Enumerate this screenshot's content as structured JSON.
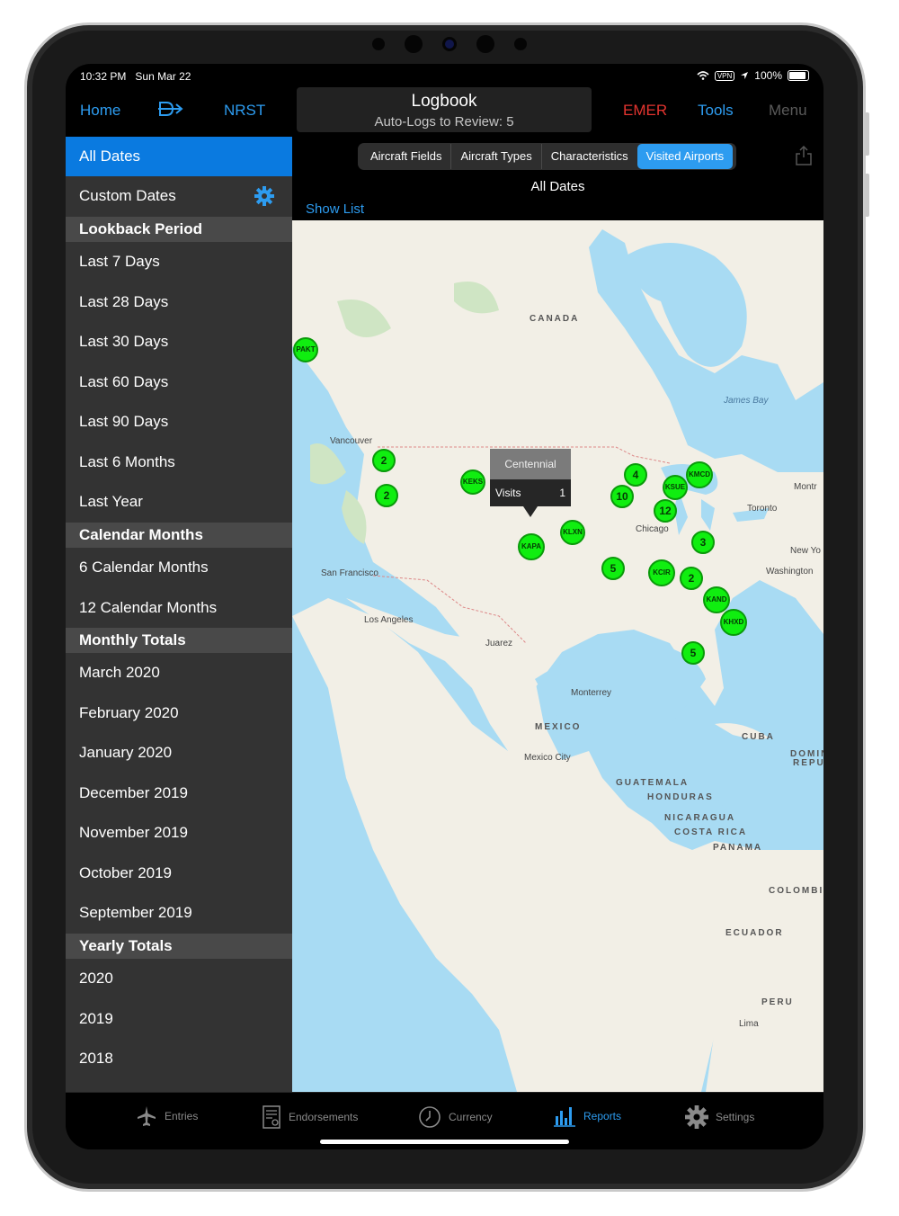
{
  "status": {
    "time": "10:32 PM",
    "date": "Sun Mar 22",
    "vpn": "VPN",
    "battery": "100%"
  },
  "nav": {
    "home": "Home",
    "nrst": "NRST",
    "title": "Logbook",
    "subtitle": "Auto-Logs to Review: 5",
    "emer": "EMER",
    "tools": "Tools",
    "menu": "Menu"
  },
  "sidebar": {
    "all_dates": "All Dates",
    "custom_dates": "Custom Dates",
    "lookback_header": "Lookback Period",
    "lookback": [
      "Last 7 Days",
      "Last 28 Days",
      "Last 30 Days",
      "Last 60 Days",
      "Last 90 Days",
      "Last 6 Months",
      "Last Year"
    ],
    "calendar_header": "Calendar Months",
    "calendar": [
      "6 Calendar Months",
      "12 Calendar Months"
    ],
    "monthly_header": "Monthly Totals",
    "monthly": [
      "March 2020",
      "February 2020",
      "January 2020",
      "December 2019",
      "November 2019",
      "October 2019",
      "September 2019"
    ],
    "yearly_header": "Yearly Totals",
    "yearly": [
      "2020",
      "2019",
      "2018"
    ]
  },
  "main": {
    "segments": [
      "Aircraft Fields",
      "Aircraft Types",
      "Characteristics",
      "Visited Airports"
    ],
    "active_segment": "Visited Airports",
    "subtitle": "All Dates",
    "show_list": "Show List"
  },
  "map": {
    "callout": {
      "name": "Centennial",
      "label": "Visits",
      "value": "1"
    },
    "pins": [
      "PAKT",
      "2",
      "2",
      "KEKS",
      "KAPA",
      "KLXN",
      "4",
      "10",
      "KSUE",
      "KMCD",
      "12",
      "3",
      "5",
      "KCIR",
      "2",
      "KAND",
      "KHXD",
      "5"
    ],
    "labels": [
      "CANADA",
      "James Bay",
      "Vancouver",
      "San Francisco",
      "Los Angeles",
      "Juarez",
      "Chicago",
      "Toronto",
      "Montr",
      "New Yo",
      "Washington",
      "Monterrey",
      "MEXICO",
      "Mexico City",
      "CUBA",
      "DOMIN",
      "REPU",
      "GUATEMALA",
      "HONDURAS",
      "NICARAGUA",
      "COSTA RICA",
      "PANAMA",
      "COLOMBI",
      "ECUADOR",
      "PERU",
      "Lima"
    ]
  },
  "tabs": [
    "Entries",
    "Endorsements",
    "Currency",
    "Reports",
    "Settings"
  ],
  "active_tab": "Reports",
  "colors": {
    "accent": "#2d9cf0",
    "emer": "#e3342f",
    "pin": "#10ee10",
    "selected_row": "#0a7ae0"
  }
}
